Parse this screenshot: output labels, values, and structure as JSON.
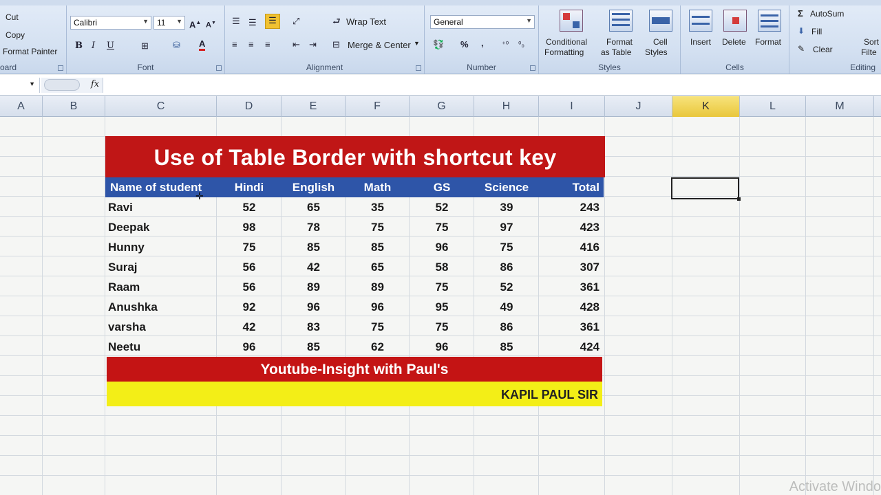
{
  "ribbon": {
    "clipboard": {
      "cut": "Cut",
      "copy": "Copy",
      "format_painter": "Format Painter",
      "label": "oard"
    },
    "font": {
      "name": "Calibri",
      "size": "11",
      "label": "Font",
      "bold": "B",
      "italic": "I",
      "underline": "U"
    },
    "alignment": {
      "wrap_text": "Wrap Text",
      "merge_center": "Merge & Center",
      "label": "Alignment"
    },
    "number": {
      "format": "General",
      "percent": "%",
      "comma": ",",
      "label": "Number"
    },
    "styles": {
      "conditional": [
        "Conditional",
        "Formatting"
      ],
      "format_table": [
        "Format",
        "as Table"
      ],
      "cell_styles": [
        "Cell",
        "Styles"
      ],
      "label": "Styles"
    },
    "cells": {
      "insert": "Insert",
      "delete": "Delete",
      "format": "Format",
      "label": "Cells"
    },
    "editing": {
      "autosum": "AutoSum",
      "fill": "Fill",
      "clear": "Clear",
      "sort": [
        "Sort",
        "Filte"
      ],
      "label": "Editing",
      "sigma": "Σ"
    }
  },
  "formula_bar": {
    "fx": "fx",
    "value": ""
  },
  "columns": [
    "A",
    "B",
    "C",
    "D",
    "E",
    "F",
    "G",
    "H",
    "I",
    "J",
    "K",
    "L",
    "M"
  ],
  "selected_column": "K",
  "sheet_table": {
    "title": "Use of Table Border with shortcut key",
    "headers": [
      "Name of student",
      "Hindi",
      "English",
      "Math",
      "GS",
      "Science",
      "Total"
    ],
    "rows": [
      [
        "Ravi",
        "52",
        "65",
        "35",
        "52",
        "39",
        "243"
      ],
      [
        "Deepak",
        "98",
        "78",
        "75",
        "75",
        "97",
        "423"
      ],
      [
        "Hunny",
        "75",
        "85",
        "85",
        "96",
        "75",
        "416"
      ],
      [
        "Suraj",
        "56",
        "42",
        "65",
        "58",
        "86",
        "307"
      ],
      [
        "Raam",
        "56",
        "89",
        "89",
        "75",
        "52",
        "361"
      ],
      [
        "Anushka",
        "92",
        "96",
        "96",
        "95",
        "49",
        "428"
      ],
      [
        "varsha",
        "42",
        "83",
        "75",
        "75",
        "86",
        "361"
      ],
      [
        "Neetu",
        "96",
        "85",
        "62",
        "96",
        "85",
        "424"
      ]
    ],
    "footer_channel": "Youtube-Insight with Paul's",
    "footer_author": "KAPIL PAUL SIR"
  },
  "watermark": "Activate Windo",
  "colors": {
    "title_red": "#c01616",
    "header_blue": "#2e55a8",
    "footer_yellow": "#f3ee17",
    "selected_col": "#e9c73c"
  }
}
